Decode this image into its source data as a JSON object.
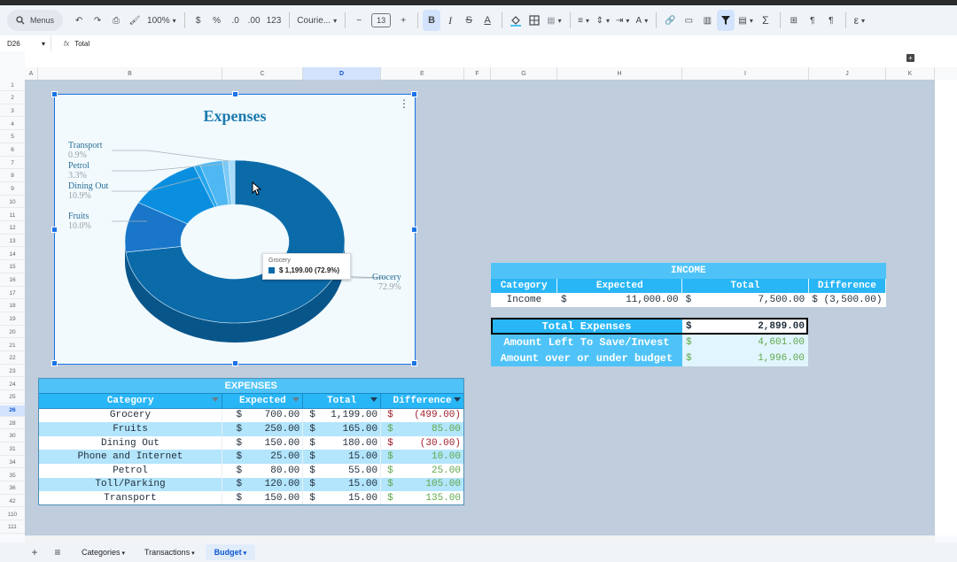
{
  "toolbar": {
    "menus_label": "Menus",
    "zoom": "100%",
    "currency": "$",
    "percent": "%",
    "dec_less": ".0",
    "dec_more": ".00",
    "number_format": "123",
    "font": "Courie...",
    "font_size": "13"
  },
  "formula_bar": {
    "cell_ref": "D26",
    "fx": "fx",
    "content": "Total"
  },
  "columns": [
    "A",
    "B",
    "C",
    "D",
    "E",
    "F",
    "G",
    "H",
    "I",
    "J",
    "K"
  ],
  "rows": [
    "1",
    "2",
    "3",
    "4",
    "5",
    "6",
    "7",
    "8",
    "9",
    "10",
    "11",
    "12",
    "13",
    "14",
    "15",
    "16",
    "17",
    "18",
    "19",
    "20",
    "21",
    "22",
    "23",
    "24",
    "25",
    "26",
    "28",
    "30",
    "31",
    "34",
    "35",
    "36",
    "42",
    "110",
    "111"
  ],
  "chart": {
    "title": "Expenses",
    "labels": [
      {
        "name": "Transport",
        "pct": "0.9%"
      },
      {
        "name": "Petrol",
        "pct": "3.3%"
      },
      {
        "name": "Dining Out",
        "pct": "10.9%"
      },
      {
        "name": "Fruits",
        "pct": "10.0%"
      },
      {
        "name": "Grocery",
        "pct": "72.9%"
      }
    ],
    "tooltip_title": "Grocery",
    "tooltip_value": "$ 1,199.00 (72.9%)"
  },
  "chart_data": {
    "type": "pie",
    "title": "Expenses",
    "categories": [
      "Grocery",
      "Fruits",
      "Dining Out",
      "Phone and Internet",
      "Petrol",
      "Toll/Parking",
      "Transport"
    ],
    "values": [
      1199.0,
      165.0,
      180.0,
      15.0,
      55.0,
      15.0,
      15.0
    ],
    "colors": [
      "#0b6aa8",
      "#1976c9",
      "#0a8fe0",
      "#26a6ee",
      "#4fb8f3",
      "#7dcaf7",
      "#a8dcfa"
    ],
    "donut": true,
    "legend": "labels"
  },
  "expenses": {
    "title": "EXPENSES",
    "headers": [
      "Category",
      "Expected",
      "Total",
      "Difference"
    ],
    "rows": [
      {
        "cat": "Grocery",
        "exp": "700.00",
        "tot": "1,199.00",
        "diff": "(499.00)",
        "neg": true
      },
      {
        "cat": "Fruits",
        "exp": "250.00",
        "tot": "165.00",
        "diff": "85.00",
        "neg": false
      },
      {
        "cat": "Dining Out",
        "exp": "150.00",
        "tot": "180.00",
        "diff": "(30.00)",
        "neg": true
      },
      {
        "cat": "Phone and Internet",
        "exp": "25.00",
        "tot": "15.00",
        "diff": "10.00",
        "neg": false
      },
      {
        "cat": "Petrol",
        "exp": "80.00",
        "tot": "55.00",
        "diff": "25.00",
        "neg": false
      },
      {
        "cat": "Toll/Parking",
        "exp": "120.00",
        "tot": "15.00",
        "diff": "105.00",
        "neg": false
      },
      {
        "cat": "Transport",
        "exp": "150.00",
        "tot": "15.00",
        "diff": "135.00",
        "neg": false
      }
    ]
  },
  "income": {
    "title": "INCOME",
    "headers": [
      "Category",
      "Expected",
      "Total",
      "Difference"
    ],
    "row": {
      "cat": "Income",
      "exp": "11,000.00",
      "tot": "7,500.00",
      "diff": "(3,500.00)"
    }
  },
  "summary": {
    "total_label": "Total Expenses",
    "total_value": "2,899.00",
    "left_label": "Amount Left To Save/Invest",
    "left_value": "4,601.00",
    "over_label": "Amount over or under budget",
    "over_value": "1,996.00",
    "dollar": "$"
  },
  "sheet_tabs": [
    {
      "label": "Categories",
      "active": false
    },
    {
      "label": "Transactions",
      "active": false
    },
    {
      "label": "Budget",
      "active": true
    }
  ]
}
